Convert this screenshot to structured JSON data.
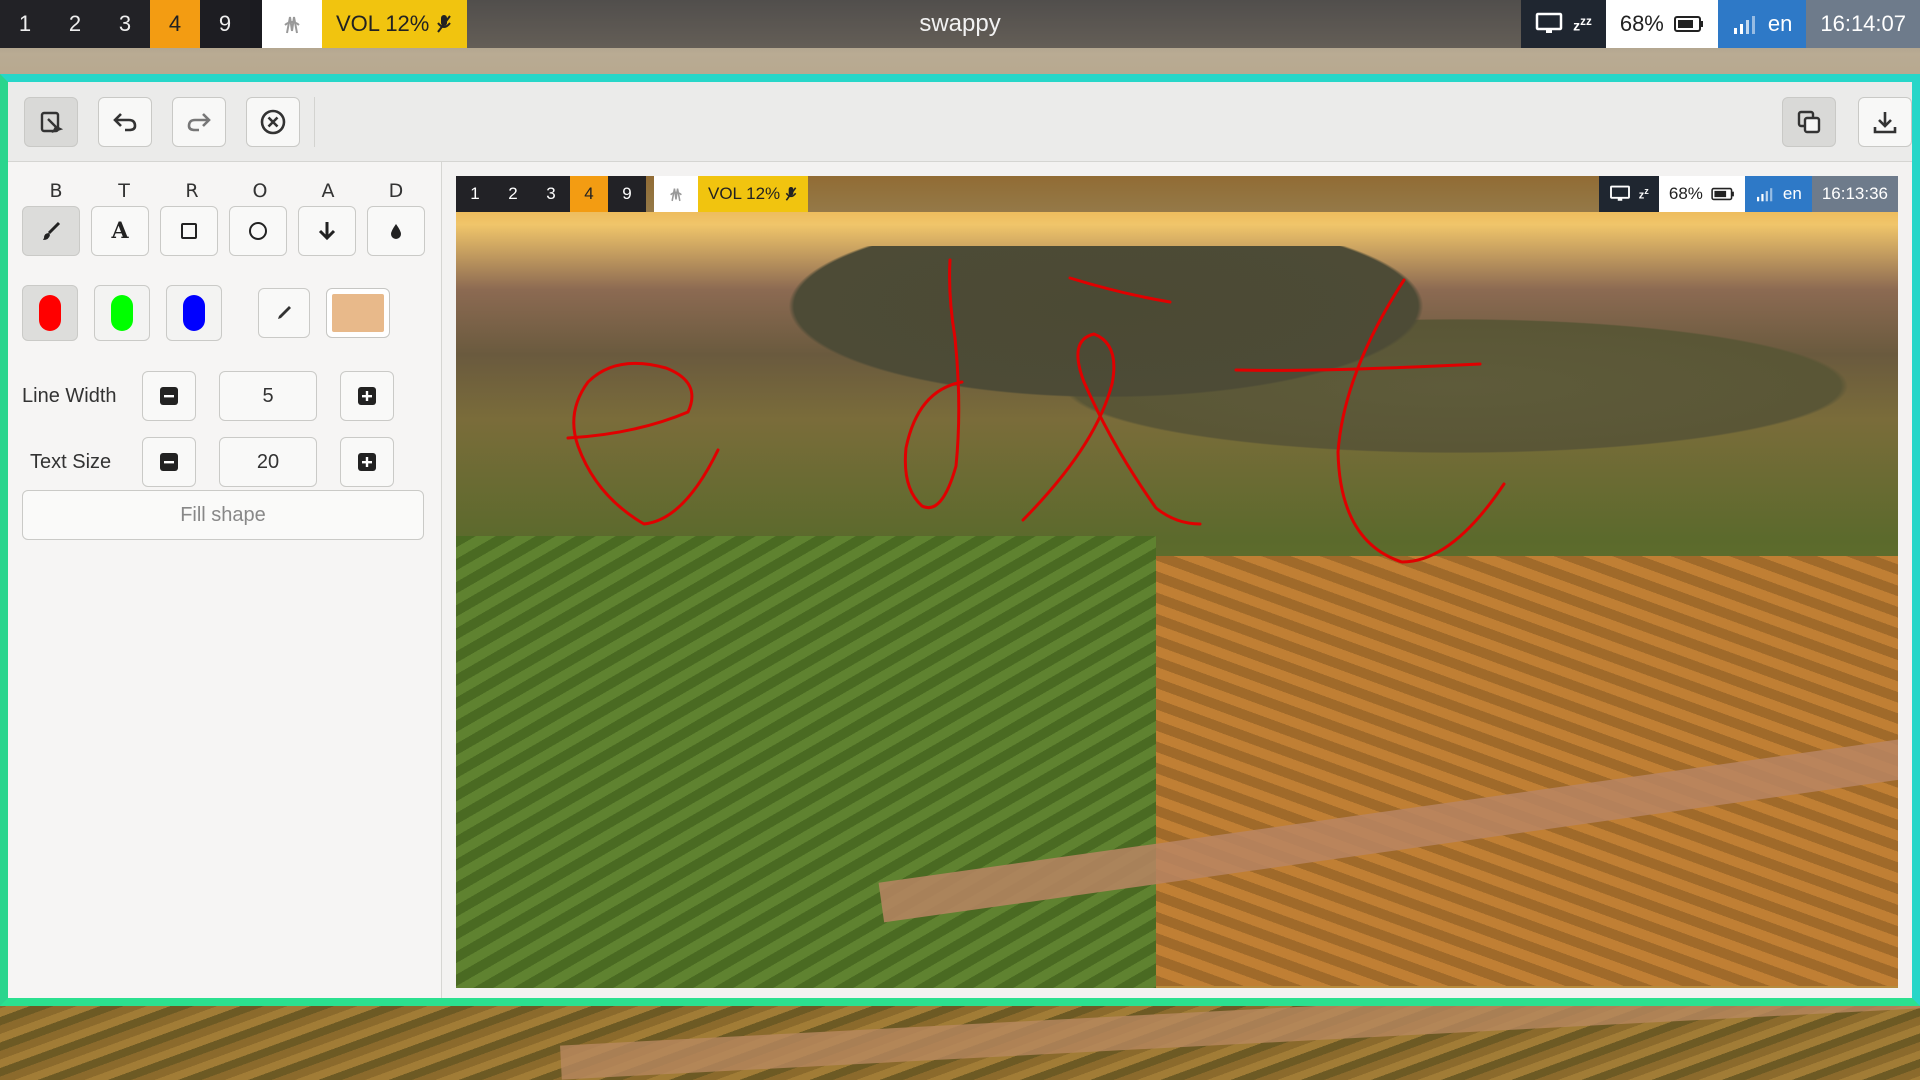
{
  "topbar": {
    "workspaces": [
      "1",
      "2",
      "3",
      "4",
      "9"
    ],
    "active_workspace": "4",
    "volume": "VOL 12%",
    "window_title": "swappy",
    "battery": "68%",
    "language": "en",
    "clock": "16:14:07"
  },
  "toolbar": {
    "buttons": [
      "paint-icon",
      "undo-icon",
      "redo-icon",
      "clear-icon"
    ],
    "right_buttons": [
      "copy-icon",
      "save-icon"
    ]
  },
  "sidebar": {
    "tool_labels": [
      "B",
      "T",
      "R",
      "O",
      "A",
      "D"
    ],
    "tools": [
      "brush",
      "text",
      "rectangle",
      "ellipse",
      "arrow",
      "blur"
    ],
    "active_tool": "brush",
    "colors": [
      "#ff0000",
      "#00ff00",
      "#0000ff"
    ],
    "active_color": "#ff0000",
    "custom_color": "#e8b98a",
    "line_width_label": "Line Width",
    "line_width_value": "5",
    "text_size_label": "Text Size",
    "text_size_value": "20",
    "fill_shape_label": "Fill shape"
  },
  "canvas": {
    "workspaces": [
      "1",
      "2",
      "3",
      "4",
      "9"
    ],
    "active_workspace": "4",
    "volume": "VOL 12%",
    "battery": "68%",
    "language": "en",
    "clock": "16:13:36",
    "stroke_color": "#e00000"
  }
}
